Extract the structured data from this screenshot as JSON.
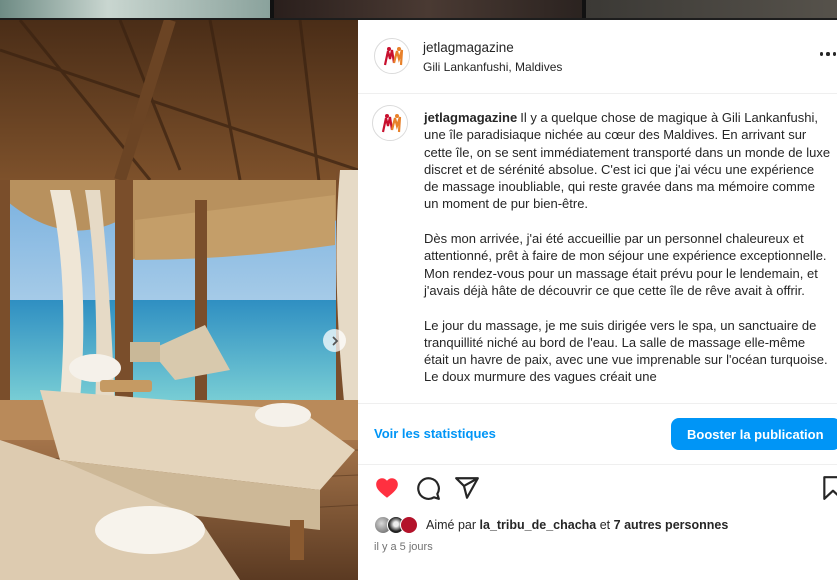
{
  "post": {
    "username": "jetlagmagazine",
    "location": "Gili Lankanfushi, Maldives",
    "caption": {
      "user": "jetlagmagazine",
      "paragraphs": [
        "Il y a quelque chose de magique à Gili Lankanfushi, une île paradisiaque nichée au cœur des Maldives. En arrivant sur cette île, on se sent immédiatement transporté dans un monde de luxe discret et de sérénité absolue. C'est ici que j'ai vécu une expérience de massage inoubliable, qui reste gravée dans ma mémoire comme un moment de pur bien-être.",
        "Dès mon arrivée, j'ai été accueillie par un personnel chaleureux et attentionné, prêt à faire de mon séjour une expérience exceptionnelle. Mon rendez-vous pour un massage était prévu pour le lendemain, et j'avais déjà hâte de découvrir ce que cette île de rêve avait à offrir.",
        "Le jour du massage, je me suis dirigée vers le spa, un sanctuaire de tranquillité niché au bord de l'eau. La salle de massage elle-même était un havre de paix, avec une vue imprenable sur l'océan turquoise. Le doux murmure des vagues créait une"
      ]
    },
    "stats_link": "Voir les statistiques",
    "boost_label": "Booster la publication",
    "likes": {
      "prefix": "Aimé par",
      "user": "la_tribu_de_chacha",
      "joiner": "et",
      "others": "7 autres personnes"
    },
    "timestamp": "il y a 5 jours"
  },
  "icons": {
    "like": "heart-filled-icon",
    "comment": "comment-icon",
    "share": "share-icon",
    "save": "bookmark-icon",
    "more": "more-horizontal-icon",
    "next": "chevron-right-icon"
  },
  "colors": {
    "accent": "#0095f6",
    "like": "#ff3040",
    "text": "#262626",
    "muted": "#737373"
  }
}
